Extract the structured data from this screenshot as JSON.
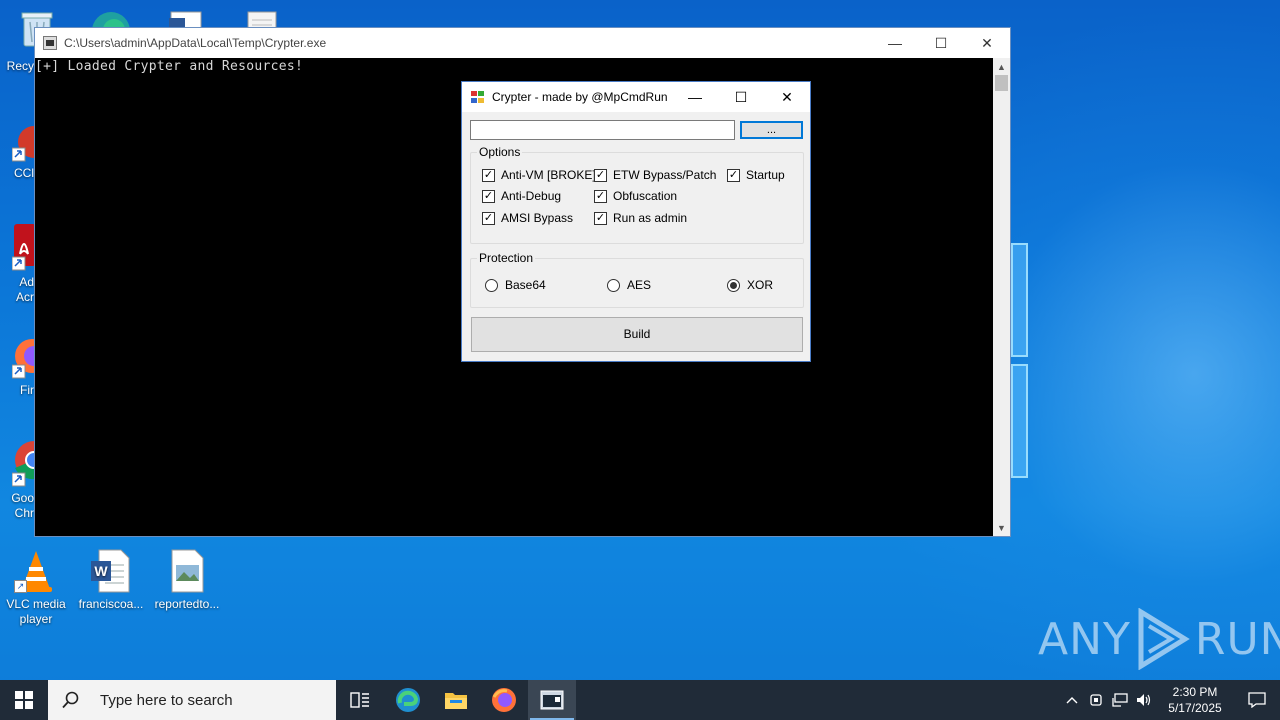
{
  "desktop": {
    "icons": [
      {
        "label": "VLC media player",
        "icon": "vlc-icon"
      },
      {
        "label": "franciscoa...",
        "icon": "word-document-icon"
      },
      {
        "label": "reportedto...",
        "icon": "image-file-icon"
      }
    ],
    "partial_labels": {
      "recycle": "Recy",
      "ccleaner": "CCl",
      "acrobat_1": "Ad",
      "acrobat_2": "Acr",
      "firefox": "Fir",
      "chrome_1": "Goo",
      "chrome_2": "Chr"
    },
    "watermark": {
      "left": "ANY",
      "right": "RUN"
    }
  },
  "console": {
    "title": "C:\\Users\\admin\\AppData\\Local\\Temp\\Crypter.exe",
    "output": "[+] Loaded Crypter and Resources!",
    "controls": {
      "minimize": "—",
      "maximize": "☐",
      "close": "✕"
    }
  },
  "dialog": {
    "title": "Crypter - made by @MpCmdRun",
    "path_value": "",
    "browse_label": "...",
    "options_label": "Options",
    "options": [
      {
        "label": "Anti-VM [BROKE]",
        "checked": true
      },
      {
        "label": "ETW Bypass/Patch",
        "checked": true
      },
      {
        "label": "Startup",
        "checked": true
      },
      {
        "label": "Anti-Debug",
        "checked": true
      },
      {
        "label": "Obfuscation",
        "checked": true
      },
      {
        "label": "AMSI Bypass",
        "checked": true
      },
      {
        "label": "Run as admin",
        "checked": true
      }
    ],
    "protection_label": "Protection",
    "protection": [
      {
        "label": "Base64",
        "selected": false
      },
      {
        "label": "AES",
        "selected": false
      },
      {
        "label": "XOR",
        "selected": true
      }
    ],
    "build_label": "Build",
    "controls": {
      "minimize": "—",
      "maximize": "☐",
      "close": "✕"
    }
  },
  "taskbar": {
    "search_placeholder": "Type here to search",
    "apps": [
      "task-view-icon",
      "edge-icon",
      "file-explorer-icon",
      "firefox-icon",
      "crypter-console-icon"
    ],
    "time": "2:30 PM",
    "date": "5/17/2025"
  }
}
